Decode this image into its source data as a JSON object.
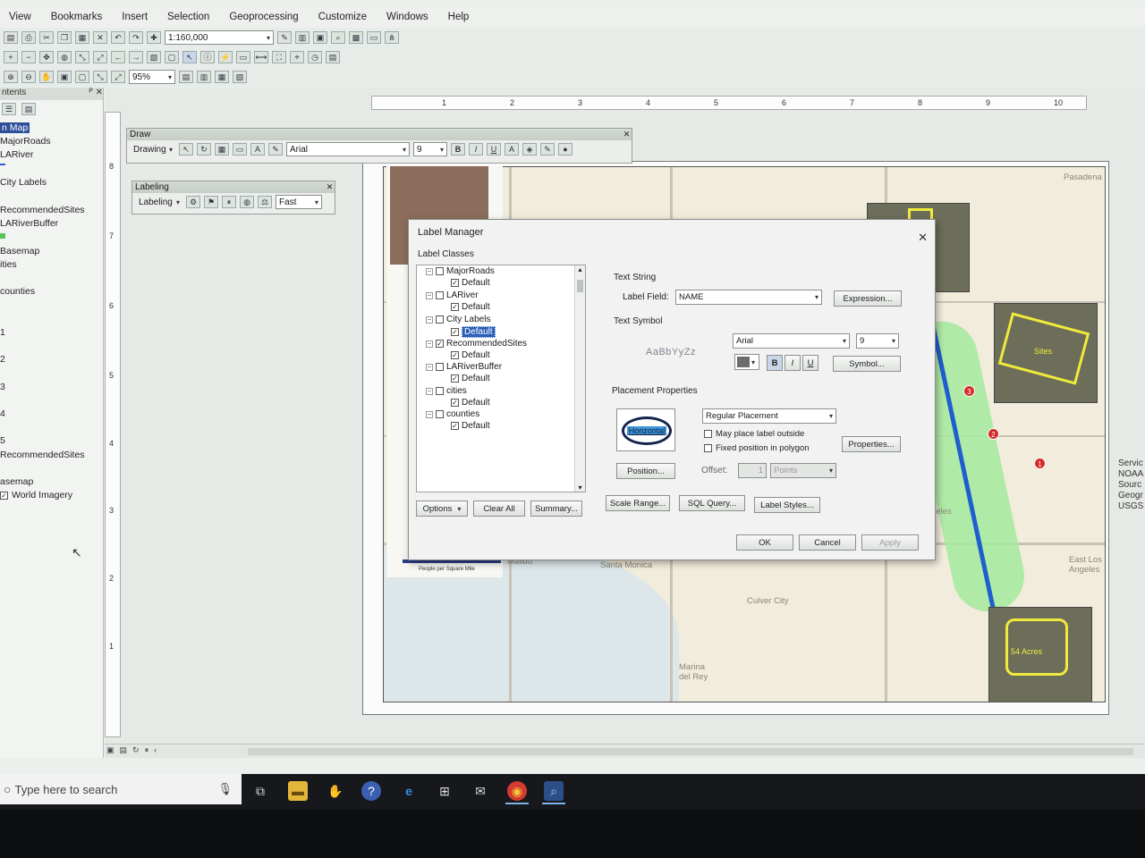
{
  "menu": [
    "View",
    "Bookmarks",
    "Insert",
    "Selection",
    "Geoprocessing",
    "Customize",
    "Windows",
    "Help"
  ],
  "toolbar": {
    "scale": "1:160,000",
    "zoom": "95%"
  },
  "toc": {
    "title": "ntents",
    "items": [
      {
        "label": "n Map",
        "selected": true
      },
      {
        "label": "MajorRoads"
      },
      {
        "label": "LARiver"
      },
      {
        "label": "City Labels"
      },
      {
        "label": "RecommendedSites"
      },
      {
        "label": "LARiverBuffer"
      },
      {
        "label": "Basemap"
      },
      {
        "label": "ities"
      },
      {
        "label": "counties"
      },
      {
        "label": "1"
      },
      {
        "label": "2"
      },
      {
        "label": "3"
      },
      {
        "label": "4"
      },
      {
        "label": "5"
      },
      {
        "label": "RecommendedSites"
      },
      {
        "label": "asemap"
      },
      {
        "label": "World Imagery"
      }
    ]
  },
  "ruler": {
    "h": [
      "1",
      "2",
      "3",
      "4",
      "5",
      "6",
      "7",
      "8",
      "9",
      "10"
    ],
    "v": [
      "8",
      "7",
      "6",
      "5",
      "4",
      "3",
      "2",
      "1"
    ]
  },
  "draw_toolbar": {
    "title": "Draw",
    "drawing": "Drawing",
    "font": "Arial",
    "size": "9"
  },
  "labeling_toolbar": {
    "title": "Labeling",
    "labeling": "Labeling",
    "mode": "Fast"
  },
  "map": {
    "labels": [
      "Pasadena",
      "Santa Monica",
      "Malibu",
      "Culver City",
      "Marina del Rey",
      "East Los Angeles",
      "geles"
    ],
    "markers": [
      "3",
      "2",
      "1"
    ],
    "site_labels": [
      "Sites",
      "54 Acres"
    ],
    "legend_caption": "People per Square Mile"
  },
  "service_text": [
    "Servic",
    "NOAA",
    "Sourc",
    "Geogr",
    "USGS"
  ],
  "dialog": {
    "title": "Label Manager",
    "label_classes_heading": "Label Classes",
    "tree": [
      {
        "layer": "MajorRoads",
        "layer_checked": false,
        "class": "Default",
        "class_checked": true,
        "selected": false
      },
      {
        "layer": "LARiver",
        "layer_checked": false,
        "class": "Default",
        "class_checked": true,
        "selected": false
      },
      {
        "layer": "City Labels",
        "layer_checked": false,
        "class": "Default",
        "class_checked": true,
        "selected": true
      },
      {
        "layer": "RecommendedSites",
        "layer_checked": true,
        "class": "Default",
        "class_checked": true,
        "selected": false
      },
      {
        "layer": "LARiverBuffer",
        "layer_checked": false,
        "class": "Default",
        "class_checked": true,
        "selected": false
      },
      {
        "layer": "cities",
        "layer_checked": false,
        "class": "Default",
        "class_checked": true,
        "selected": false
      },
      {
        "layer": "counties",
        "layer_checked": false,
        "class": "Default",
        "class_checked": true,
        "selected": false
      }
    ],
    "text_string": {
      "heading": "Text String",
      "label_field_label": "Label Field:",
      "label_field_value": "NAME",
      "expression_button": "Expression..."
    },
    "text_symbol": {
      "heading": "Text Symbol",
      "preview": "AaBbYyZz",
      "font": "Arial",
      "size": "9",
      "bold": "B",
      "italic": "I",
      "underline": "U",
      "symbol_button": "Symbol..."
    },
    "placement": {
      "heading": "Placement Properties",
      "preview_label": "Horizontal",
      "placement_value": "Regular Placement",
      "may_place_outside": "May place label outside",
      "fixed_position": "Fixed position in polygon",
      "properties_button": "Properties...",
      "position_button": "Position...",
      "offset_label": "Offset:",
      "offset_value": "1",
      "offset_units": "Points"
    },
    "buttons": {
      "options": "Options",
      "clear_all": "Clear All",
      "summary": "Summary...",
      "scale_range": "Scale Range...",
      "sql_query": "SQL Query...",
      "label_styles": "Label Styles...",
      "ok": "OK",
      "cancel": "Cancel",
      "apply": "Apply"
    }
  },
  "taskbar": {
    "search_placeholder": "Type here to search"
  },
  "colors": {
    "selection": "#2b5fb8",
    "site_outline": "#f0ea3c",
    "river": "#1e5fd0",
    "buffer": "#9fe39a",
    "marker": "#d62a2a"
  }
}
